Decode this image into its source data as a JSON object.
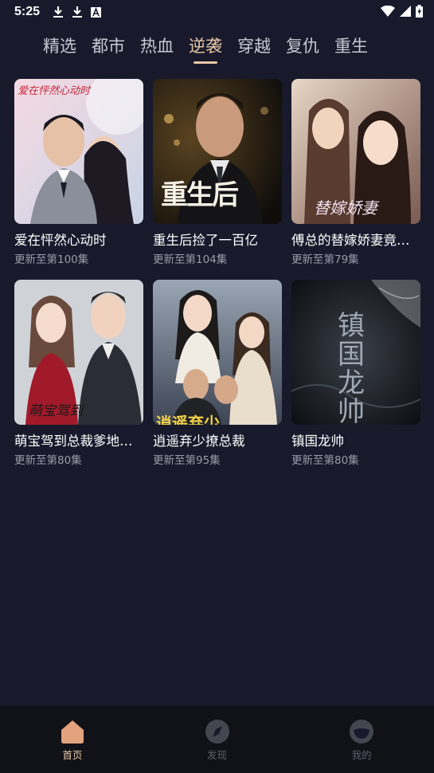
{
  "status_bar": {
    "time": "5:25"
  },
  "tabs": [
    {
      "label": "精选",
      "active": false
    },
    {
      "label": "都市",
      "active": false
    },
    {
      "label": "热血",
      "active": false
    },
    {
      "label": "逆袭",
      "active": true
    },
    {
      "label": "穿越",
      "active": false
    },
    {
      "label": "复仇",
      "active": false
    },
    {
      "label": "重生",
      "active": false
    }
  ],
  "dramas": [
    {
      "title": "爱在怦然心动时",
      "subtitle": "更新至第100集",
      "cover_text": "爱在怦然心动时"
    },
    {
      "title": "重生后捡了一百亿",
      "subtitle": "更新至第104集",
      "cover_text": "重生后"
    },
    {
      "title": "傅总的替嫁娇妻竟…",
      "subtitle": "更新至第79集",
      "cover_text": "替嫁娇妻"
    },
    {
      "title": "萌宝驾到总裁爹地…",
      "subtitle": "更新至第80集",
      "cover_text": "萌宝驾到"
    },
    {
      "title": "逍遥弃少撩总裁",
      "subtitle": "更新至第95集",
      "cover_text": "逍遥弃少"
    },
    {
      "title": "镇国龙帅",
      "subtitle": "更新至第80集",
      "cover_text": "镇国龙帅"
    }
  ],
  "bottom_nav": [
    {
      "label": "首页",
      "icon": "home-icon",
      "active": true
    },
    {
      "label": "发现",
      "icon": "compass-icon",
      "active": false
    },
    {
      "label": "我的",
      "icon": "profile-icon",
      "active": false
    }
  ],
  "colors": {
    "background": "#181a2c",
    "accent": "#e9c7a7",
    "nav_bg": "#111218",
    "muted": "#9a9ba8"
  }
}
